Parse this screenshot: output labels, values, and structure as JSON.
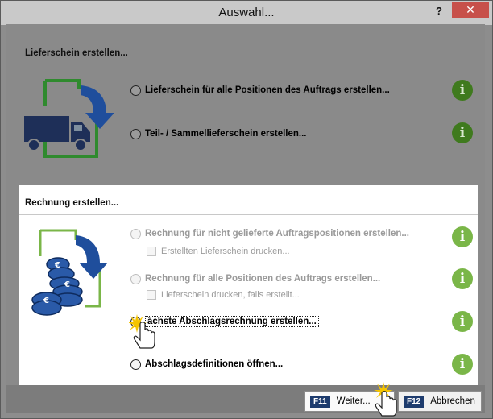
{
  "window": {
    "title": "Auswahl...",
    "help_label": "?",
    "close_label": "✕"
  },
  "delivery": {
    "title": "Lieferschein erstellen...",
    "options": [
      "Lieferschein für alle Positionen des Auftrags erstellen...",
      "Teil- / Sammellieferschein erstellen..."
    ]
  },
  "invoice": {
    "title": "Rechnung erstellen...",
    "options": [
      "Rechnung für nicht gelieferte Auftragspositionen erstellen...",
      "Rechnung für alle Positionen des Auftrags erstellen...",
      "ächste Abschlagsrechnung erstellen...",
      "Abschlagsdefinitionen öffnen..."
    ],
    "checkboxes": [
      "Erstellten Lieferschein drucken...",
      "Lieferschein drucken, falls erstellt..."
    ]
  },
  "info_glyph": "i",
  "buttons": {
    "next_key": "F11",
    "next_label": "Weiter...",
    "cancel_key": "F12",
    "cancel_label": "Abbrechen"
  },
  "colors": {
    "info_green": "#7ab648",
    "key_navy": "#1e3c6e",
    "close_red": "#c7504a",
    "icon_green": "#2f8a2e",
    "icon_blue": "#1f4e9c"
  }
}
